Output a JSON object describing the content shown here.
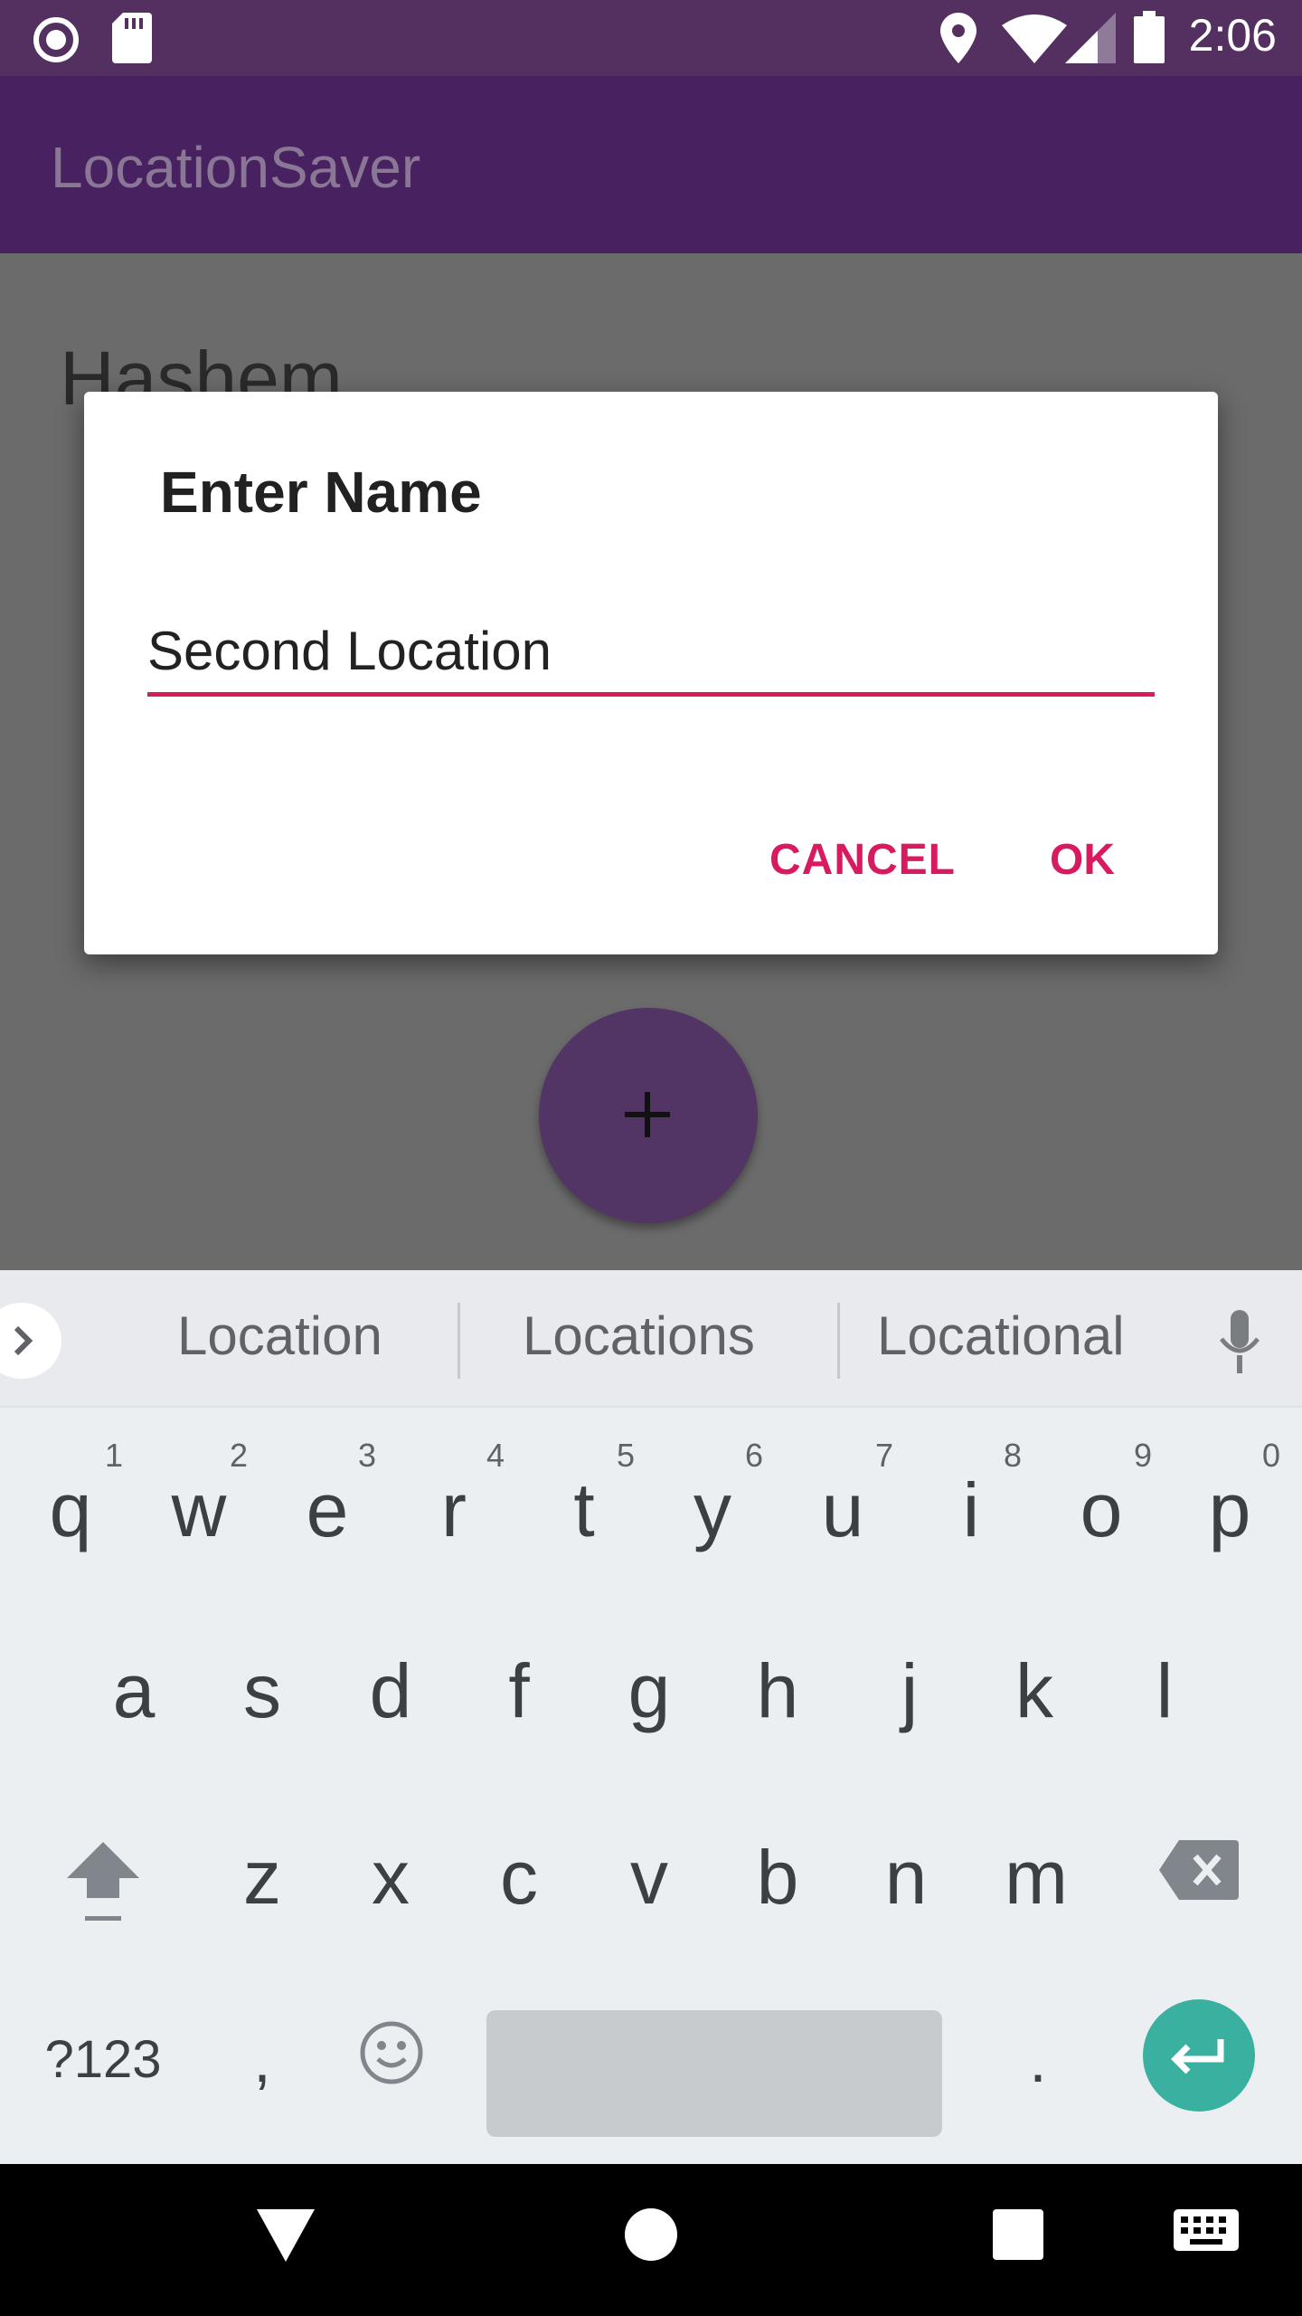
{
  "status_bar": {
    "time": "2:06"
  },
  "app_bar": {
    "title": "LocationSaver"
  },
  "content": {
    "item_name": "Hashem",
    "fab_label": "+"
  },
  "dialog": {
    "title": "Enter Name",
    "input_value": "Second Location",
    "cancel_label": "CANCEL",
    "ok_label": "OK"
  },
  "keyboard": {
    "suggestions": [
      "Location",
      "Locations",
      "Locational"
    ],
    "row1": [
      "q",
      "w",
      "e",
      "r",
      "t",
      "y",
      "u",
      "i",
      "o",
      "p"
    ],
    "row1_hints": [
      "1",
      "2",
      "3",
      "4",
      "5",
      "6",
      "7",
      "8",
      "9",
      "0"
    ],
    "row2": [
      "a",
      "s",
      "d",
      "f",
      "g",
      "h",
      "j",
      "k",
      "l"
    ],
    "row3": [
      "z",
      "x",
      "c",
      "v",
      "b",
      "n",
      "m"
    ],
    "symbols_label": "?123",
    "comma": ",",
    "period": "."
  },
  "colors": {
    "status_bar": "#53305f",
    "app_bar": "#482260",
    "accent": "#d81b60",
    "fab": "#523465",
    "enter_key": "#3ab0a0"
  }
}
